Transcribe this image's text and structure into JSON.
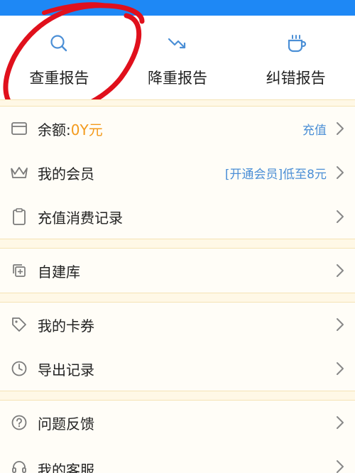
{
  "quick_actions": [
    {
      "label": "查重报告",
      "icon": "search-icon"
    },
    {
      "label": "降重报告",
      "icon": "trend-down-icon"
    },
    {
      "label": "纠错报告",
      "icon": "coffee-cup-icon"
    }
  ],
  "account": {
    "balance_label": "余额:",
    "balance_value": "0Y元",
    "recharge": "充值"
  },
  "menu": {
    "membership": {
      "label": "我的会员",
      "promo": "[开通会员]低至8元"
    },
    "records": {
      "label": "充值消费记录"
    },
    "selfbuild": {
      "label": "自建库"
    },
    "coupons": {
      "label": "我的卡券"
    },
    "export": {
      "label": "导出记录"
    },
    "feedback": {
      "label": "问题反馈"
    },
    "service": {
      "label": "我的客服"
    }
  },
  "colors": {
    "topbar": "#1e88f5",
    "accent_blue": "#4b8fd6",
    "orange": "#f39a1c",
    "annotation_red": "#e0101c"
  }
}
